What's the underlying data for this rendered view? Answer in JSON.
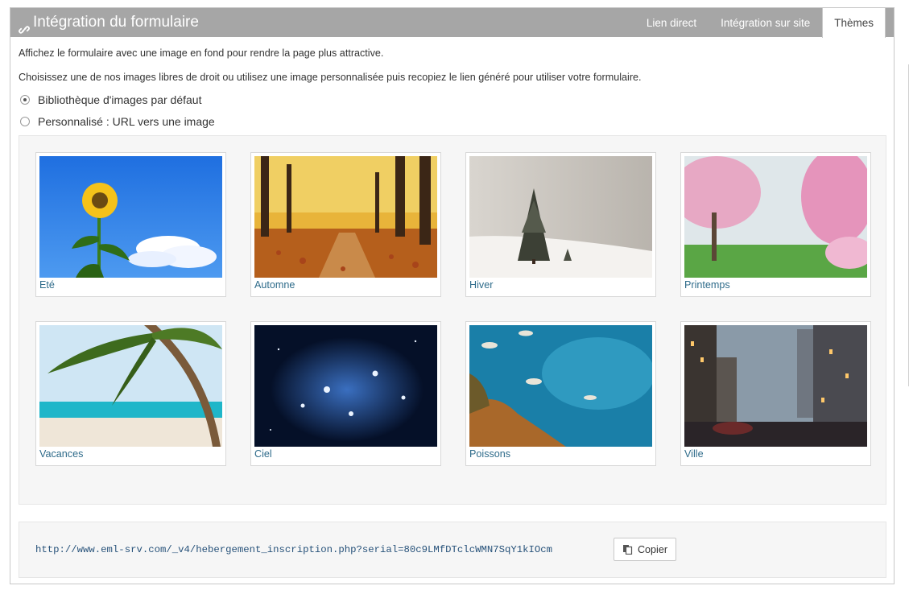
{
  "panel": {
    "title": "Intégration du formulaire",
    "tabs": [
      {
        "label": "Lien direct"
      },
      {
        "label": "Intégration sur site"
      },
      {
        "label": "Thèmes"
      }
    ]
  },
  "intro": {
    "line1": "Affichez le formulaire avec une image en fond pour rendre la page plus attractive.",
    "line2": "Choisissez une de nos images libres de droit ou utilisez une image personnalisée puis recopiez le lien généré pour utiliser votre formulaire."
  },
  "options": [
    {
      "label": "Bibliothèque d'images par défaut",
      "checked": true
    },
    {
      "label": "Personnalisé : URL vers une image",
      "checked": false
    }
  ],
  "themes": [
    {
      "label": "Eté",
      "icon": "sunflower-sky-image"
    },
    {
      "label": "Automne",
      "icon": "autumn-forest-image"
    },
    {
      "label": "Hiver",
      "icon": "snowy-tree-image"
    },
    {
      "label": "Printemps",
      "icon": "blossom-tree-image"
    },
    {
      "label": "Vacances",
      "icon": "palm-beach-image"
    },
    {
      "label": "Ciel",
      "icon": "star-cluster-image"
    },
    {
      "label": "Poissons",
      "icon": "coral-reef-fish-image"
    },
    {
      "label": "Ville",
      "icon": "city-street-image"
    }
  ],
  "url": {
    "value": "http://www.eml-srv.com/_v4/hebergement_inscription.php?serial=80c9LMfDTclcWMN7SqY1kIOcm",
    "copy_label": "Copier"
  },
  "colors": {
    "header": "#a6a6a6",
    "link": "#2e6b8a",
    "url": "#27527a"
  }
}
